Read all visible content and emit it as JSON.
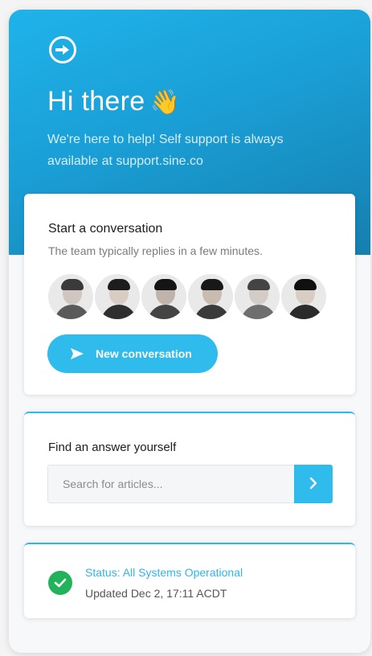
{
  "header": {
    "greeting": "Hi there",
    "wave_emoji": "👋",
    "intro": "We're here to help! Self support is always available at support.sine.co",
    "logo_icon": "arrow-circle-icon"
  },
  "conversation": {
    "title": "Start a conversation",
    "subtitle": "The team typically replies in a few minutes.",
    "team_avatars": [
      {
        "name": "avatar-1",
        "tone": "#cfc6bf",
        "shirt": "#5a5a5a",
        "hair": "#3a3a3a"
      },
      {
        "name": "avatar-2",
        "tone": "#d9ccc3",
        "shirt": "#2f2f2f",
        "hair": "#1d1d1d"
      },
      {
        "name": "avatar-3",
        "tone": "#bfb3ab",
        "shirt": "#444444",
        "hair": "#151515"
      },
      {
        "name": "avatar-4",
        "tone": "#c9bbb0",
        "shirt": "#3a3a3a",
        "hair": "#181818"
      },
      {
        "name": "avatar-5",
        "tone": "#d4ccc6",
        "shirt": "#6e6e6e",
        "hair": "#444444"
      },
      {
        "name": "avatar-6",
        "tone": "#d8cdc5",
        "shirt": "#2b2b2b",
        "hair": "#101010"
      }
    ],
    "button_label": "New conversation"
  },
  "find": {
    "title": "Find an answer yourself",
    "search_placeholder": "Search for articles..."
  },
  "status": {
    "link_text": "Status: All Systems Operational",
    "updated_text": "Updated Dec 2, 17:11 ACDT"
  },
  "colors": {
    "accent": "#2fbcec",
    "header_start": "#1fb3ea",
    "header_end": "#167fae",
    "success": "#22b25a"
  }
}
